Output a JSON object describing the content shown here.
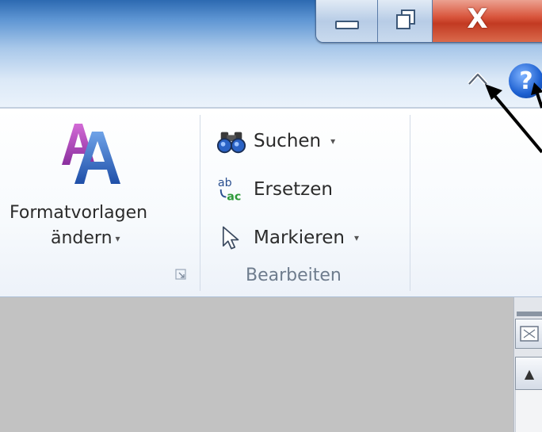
{
  "window_controls": {
    "minimize_icon": "minimize-icon",
    "restore_icon": "restore-icon",
    "close_glyph": "X"
  },
  "ribbon": {
    "collapse_icon": "chevron-up-icon",
    "help_glyph": "?",
    "formatvorlagen": {
      "label_line1": "Formatvorlagen",
      "label_line2": "ändern",
      "dropdown": "▾"
    },
    "bearbeiten": {
      "group_label": "Bearbeiten",
      "items": [
        {
          "label": "Suchen",
          "icon": "binoculars-icon",
          "dropdown": "▾"
        },
        {
          "label": "Ersetzen",
          "icon": "replace-icon"
        },
        {
          "label": "Markieren",
          "icon": "select-cursor-icon",
          "dropdown": "▾"
        }
      ]
    },
    "replace_icon_text": {
      "ab": "ab",
      "ac": "ac"
    }
  },
  "scrollbar": {
    "up_arrow": "▲"
  },
  "colors": {
    "title_gradient_top": "#2d6ab1",
    "close_red": "#c23a22",
    "workspace": "#c2c2c2",
    "group_label": "#6e7c8d"
  }
}
